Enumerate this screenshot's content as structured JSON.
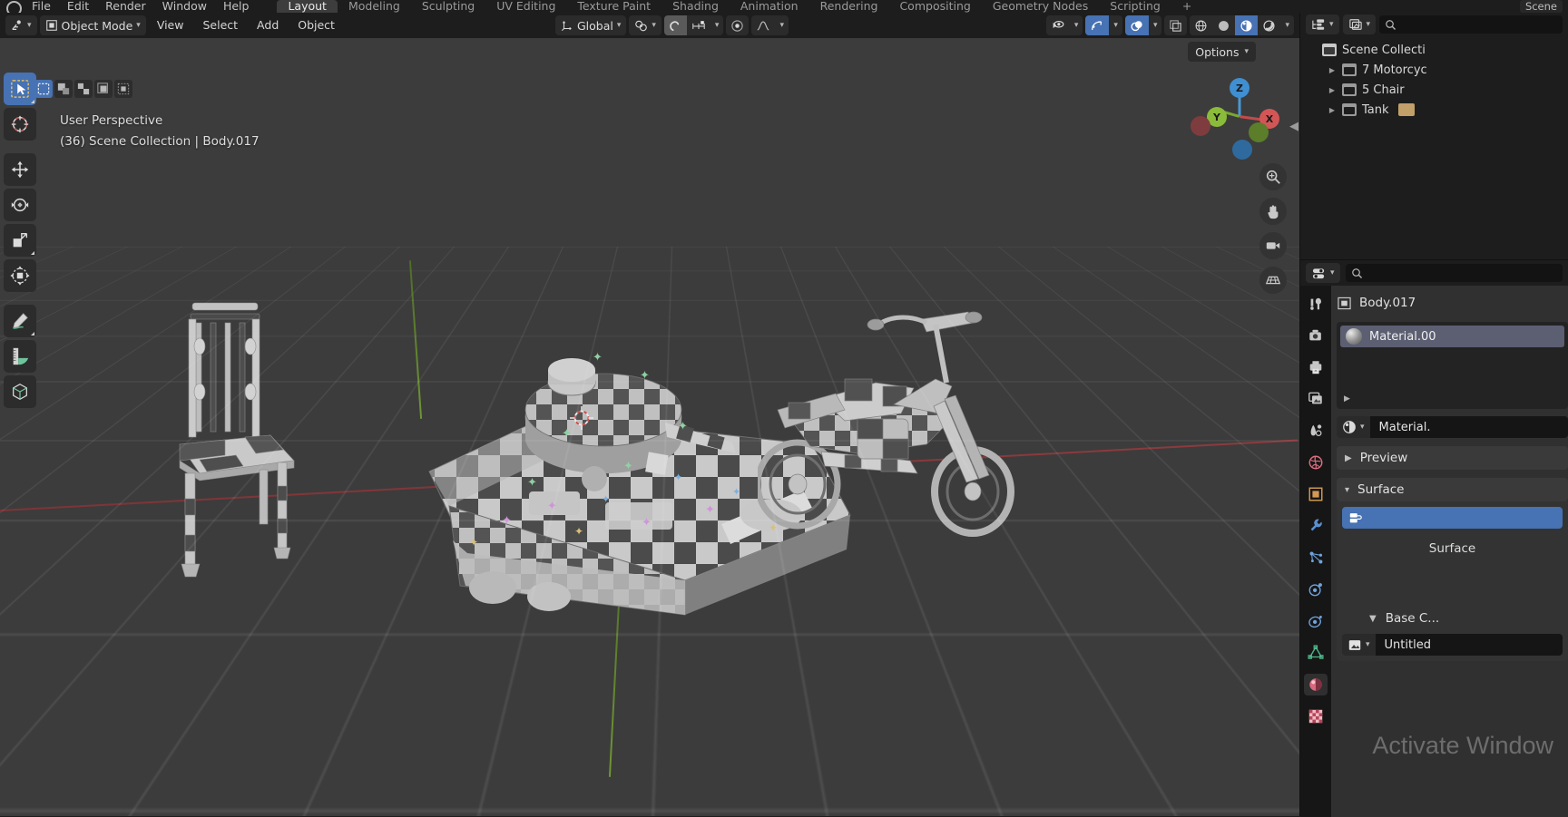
{
  "app": {
    "menus": [
      "File",
      "Edit",
      "Render",
      "Window",
      "Help"
    ],
    "workspaces": [
      "Layout",
      "Modeling",
      "Sculpting",
      "UV Editing",
      "Texture Paint",
      "Shading",
      "Animation",
      "Rendering",
      "Compositing",
      "Geometry Nodes",
      "Scripting"
    ],
    "active_workspace": "Layout",
    "scene_name": "Scene",
    "plus_label": "+"
  },
  "viewport_header": {
    "editor_type_icon": "editor-type-icon",
    "mode": "Object Mode",
    "menus": [
      "View",
      "Select",
      "Add",
      "Object"
    ],
    "transform_orientation": "Global",
    "snap_icon": "snap-magnet-icon",
    "proportional_icon": "proportional-edit-icon",
    "falloff_icon": "proportional-falloff-icon",
    "visibility_icon": "visibility-eye-icon",
    "gizmo_icon": "gizmo-icon",
    "overlays_icon": "overlays-icon",
    "xray_icon": "xray-icon",
    "shading_modes": [
      "wireframe",
      "solid",
      "material-preview",
      "rendered"
    ],
    "active_shading": "material-preview"
  },
  "select_modes": [
    "tweak",
    "select-box",
    "select-circle",
    "select-lasso",
    "select-extend"
  ],
  "active_select_mode": "tweak",
  "toolbar": {
    "tools": [
      {
        "name": "tweak-tool",
        "active": true
      },
      {
        "name": "cursor-tool",
        "active": false
      },
      {
        "name": "move-tool",
        "active": false
      },
      {
        "name": "rotate-tool",
        "active": false
      },
      {
        "name": "scale-tool",
        "active": false
      },
      {
        "name": "transform-tool",
        "active": false
      },
      {
        "name": "annotate-tool",
        "active": false
      },
      {
        "name": "measure-tool",
        "active": false
      },
      {
        "name": "add-cube-tool",
        "active": false
      }
    ]
  },
  "viewport": {
    "perspective_label": "User Perspective",
    "scene_info": "(36) Scene Collection | Body.017",
    "options_label": "Options",
    "gizmo_axes": [
      "X",
      "Y",
      "Z"
    ],
    "nav_buttons": [
      "zoom-icon",
      "pan-hand-icon",
      "camera-icon",
      "perspective-grid-icon"
    ],
    "colors": {
      "background": "#3c3c3c",
      "grid": "#4e4e4e",
      "x_axis": "#8d3b3e",
      "y_axis": "#6f9635",
      "accent_blue": "#4772b3"
    }
  },
  "outliner": {
    "display_mode_icon": "outliner-display-mode-icon",
    "filter_icon": "outliner-filter-icon",
    "search_icon": "search-icon",
    "search_placeholder": "",
    "root": "Scene Collecti",
    "items": [
      {
        "label": "7 Motorcyc",
        "icon": "collection-icon"
      },
      {
        "label": "5 Chair",
        "icon": "collection-icon"
      },
      {
        "label": "Tank",
        "icon": "collection-icon"
      }
    ]
  },
  "properties": {
    "editor_icon": "properties-editor-icon",
    "search_icon": "search-icon",
    "object_name": "Body.017",
    "object_icon": "object-data-icon",
    "material_slot": "Material.00",
    "material_field": "Material.",
    "material_browse_icon": "material-browse-icon",
    "tabs": [
      {
        "name": "tool-tab",
        "active": false
      },
      {
        "name": "render-tab",
        "active": false
      },
      {
        "name": "output-tab",
        "active": false
      },
      {
        "name": "view-layer-tab",
        "active": false
      },
      {
        "name": "scene-tab",
        "active": false
      },
      {
        "name": "world-tab",
        "active": false
      },
      {
        "name": "object-tab",
        "active": false
      },
      {
        "name": "modifier-tab",
        "active": false
      },
      {
        "name": "particles-tab",
        "active": false
      },
      {
        "name": "physics-tab",
        "active": false
      },
      {
        "name": "constraints-tab",
        "active": false
      },
      {
        "name": "data-tab",
        "active": false
      },
      {
        "name": "material-tab",
        "active": true
      },
      {
        "name": "texture-tab",
        "active": false
      }
    ],
    "panels": {
      "preview": "Preview",
      "surface": "Surface",
      "surface_button": "",
      "surface_sublabel": "Surface",
      "base_color": "Base C...",
      "texture_value": "Untitled"
    }
  },
  "watermark": "Activate Window"
}
